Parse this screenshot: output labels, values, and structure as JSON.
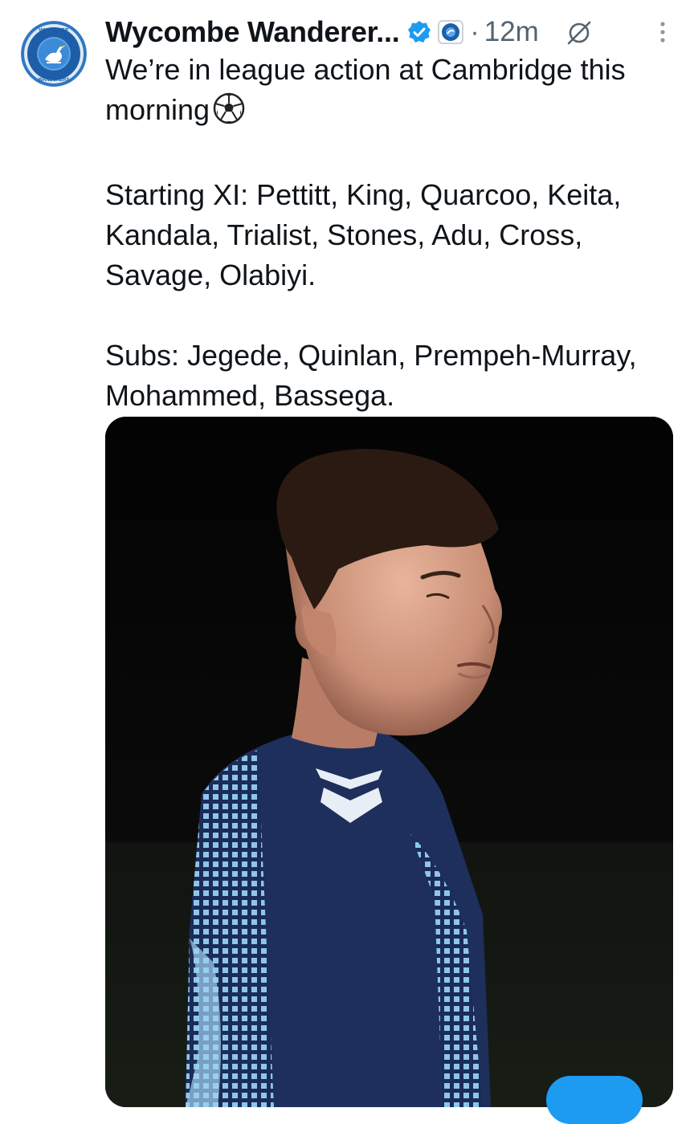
{
  "tweet": {
    "author_name": "Wycombe Wanderer...",
    "separator": "·",
    "timestamp": "12m",
    "text_line1": "We’re in league action at Cambridge this",
    "text_line2": "morning",
    "starting_xi": "Starting XI: Pettitt, King, Quarcoo, Keita, Kandala, Trialist, Stones, Adu, Cross, Savage, Olabiyi.",
    "subs": "Subs: Jegede, Quinlan, Prempeh-Murray, Mohammed, Bassega.",
    "avatar_ring_text_top": "WYCOMBE",
    "avatar_ring_text_bottom": "WANDERERS"
  },
  "icons": {
    "verified": "verified-badge-icon",
    "affiliation": "club-affiliate-icon",
    "mute": "mute-icon",
    "more": "more-vertical-icon",
    "emoji": "soccer-ball-icon"
  },
  "colors": {
    "accent": "#1d9bf0",
    "text": "#0f1419",
    "secondary": "#536471",
    "club_blue": "#3a8fd6"
  }
}
